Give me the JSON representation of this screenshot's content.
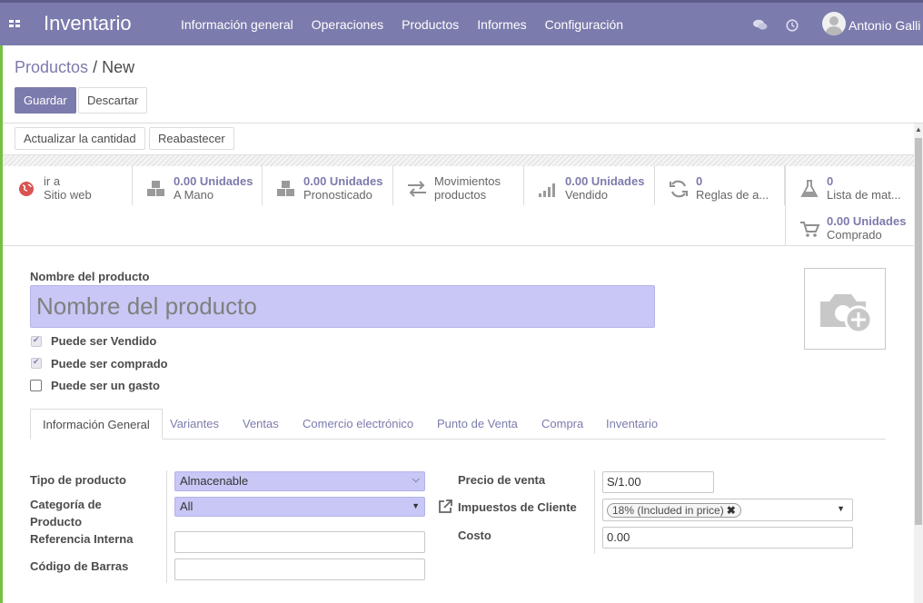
{
  "navbar": {
    "brand": "Inventario",
    "menu": [
      "Información general",
      "Operaciones",
      "Productos",
      "Informes",
      "Configuración"
    ],
    "user": "Antonio Galli",
    "color": "#7c7bad"
  },
  "breadcrumb": {
    "parent": "Productos",
    "separator": "/",
    "current": "New"
  },
  "actions": {
    "save": "Guardar",
    "discard": "Descartar"
  },
  "statusbar": {
    "update_qty": "Actualizar la cantidad",
    "replenish": "Reabastecer"
  },
  "smart_buttons": [
    {
      "icon": "globe-icon",
      "line1": "ir a",
      "line2": "Sitio web"
    },
    {
      "icon": "cubes-icon",
      "value": "0.00 Unidades",
      "label": "A Mano"
    },
    {
      "icon": "cubes-icon",
      "value": "0.00 Unidades",
      "label": "Pronosticado"
    },
    {
      "icon": "exchange-icon",
      "line1": "Movimientos",
      "line2": "productos"
    },
    {
      "icon": "signal-icon",
      "value": "0.00 Unidades",
      "label": "Vendido"
    },
    {
      "icon": "refresh-icon",
      "value": "0",
      "label": "Reglas de a..."
    },
    {
      "icon": "flask-icon",
      "value": "0",
      "label": "Lista de mat..."
    },
    {
      "icon": "cart-icon",
      "value": "0.00 Unidades",
      "label": "Comprado"
    }
  ],
  "form": {
    "name_label": "Nombre del producto",
    "name_placeholder": "Nombre del producto",
    "can_be_sold": {
      "label": "Puede ser Vendido",
      "checked": true
    },
    "can_be_purchased": {
      "label": "Puede ser comprado",
      "checked": true
    },
    "can_be_expensed": {
      "label": "Puede ser un gasto",
      "checked": false
    }
  },
  "tabs": [
    "Información General",
    "Variantes",
    "Ventas",
    "Comercio electrónico",
    "Punto de Venta",
    "Compra",
    "Inventario"
  ],
  "general": {
    "product_type": {
      "label": "Tipo de producto",
      "value": "Almacenable"
    },
    "category": {
      "label_line1": "Categoría de",
      "label_line2": "Producto",
      "value": "All"
    },
    "internal_ref": {
      "label": "Referencia Interna",
      "value": ""
    },
    "barcode": {
      "label": "Código de Barras",
      "value": ""
    },
    "sale_price": {
      "label": "Precio de venta",
      "value": "S/1.00"
    },
    "customer_taxes": {
      "label": "Impuestos de Cliente",
      "tag": "18% (Included in price)"
    },
    "cost": {
      "label": "Costo",
      "value": "0.00"
    }
  }
}
